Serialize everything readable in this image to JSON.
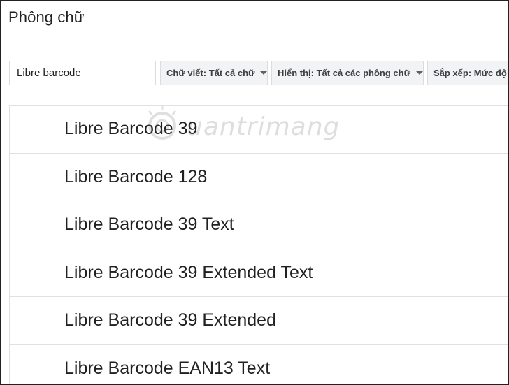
{
  "dialog": {
    "title": "Phông chữ"
  },
  "search": {
    "value": "Libre barcode"
  },
  "filters": {
    "script": "Chữ viết: Tất cả chữ",
    "show": "Hiển thị: Tất cả các phông chữ",
    "sort": "Sắp xếp: Mức độ"
  },
  "fonts": [
    {
      "name": "Libre Barcode 39"
    },
    {
      "name": "Libre Barcode 128"
    },
    {
      "name": "Libre Barcode 39 Text"
    },
    {
      "name": "Libre Barcode 39 Extended Text"
    },
    {
      "name": "Libre Barcode 39 Extended"
    },
    {
      "name": "Libre Barcode EAN13 Text"
    }
  ],
  "watermark": {
    "text": "uantrimang",
    "icon": "sun-logo-icon"
  },
  "colors": {
    "accent": "#1a73e8",
    "filter_bg": "#f1f3f4",
    "border": "#dadce0"
  }
}
